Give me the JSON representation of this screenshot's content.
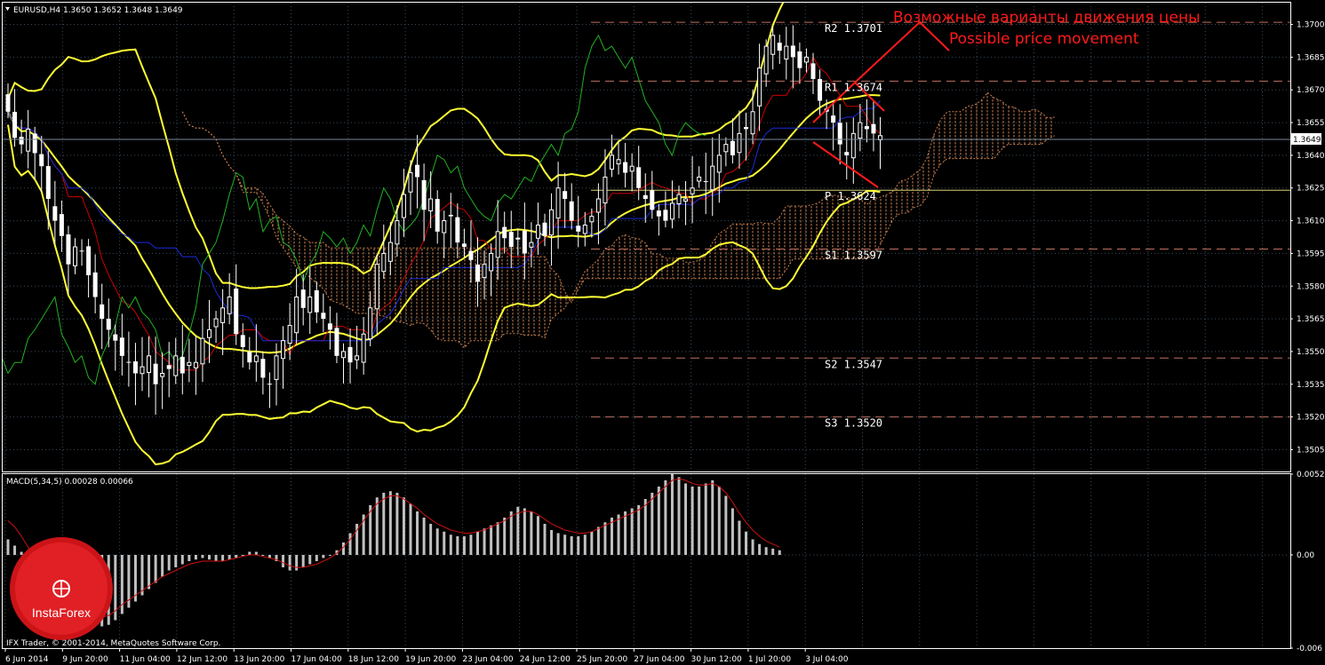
{
  "header": {
    "symbol_info": "EURUSD,H4  1.3650 1.3652 1.3648 1.3649",
    "macd_info": "MACD(5,34,5) 0.00028 0.00066",
    "copyright": "IFX Trader, © 2001-2014, MetaQuotes Software Corp."
  },
  "colors": {
    "background": "#000000",
    "grid": "#3a4a5a",
    "bull_candle": "#ffffff",
    "bear_candle": "#ffffff",
    "bollinger": "#ffff33",
    "tenkan": "#cc0000",
    "kijun": "#1a2bd8",
    "chikou": "#22b222",
    "kumo": "#c98050",
    "pivot_lines": "#c07060",
    "pivot_line": "#d8d070",
    "annotation": "#ff1a1a",
    "macd_hist": "#c0c0c0",
    "macd_signal": "#cc1111"
  },
  "annotation": {
    "text_ru": "Возможные варианты движения цены",
    "text_en": "Possible price movement"
  },
  "logo": {
    "text": "InstaForex"
  },
  "chart_data": [
    {
      "type": "candlestick",
      "title": "EURUSD,H4",
      "ylim": [
        1.3495,
        1.371
      ],
      "y_ticks": [
        "1.3700",
        "1.3685",
        "1.3670",
        "1.3655",
        "1.3640",
        "1.3625",
        "1.3610",
        "1.3595",
        "1.3580",
        "1.3565",
        "1.3550",
        "1.3535",
        "1.3520",
        "1.3505"
      ],
      "current_price": "1.3649",
      "x_labels": [
        "6 Jun 2014",
        "9 Jun 20:00",
        "11 Jun 04:00",
        "12 Jun 12:00",
        "13 Jun 20:00",
        "17 Jun 04:00",
        "18 Jun 12:00",
        "19 Jun 20:00",
        "23 Jun 04:00",
        "24 Jun 12:00",
        "25 Jun 20:00",
        "27 Jun 04:00",
        "30 Jun 12:00",
        "1 Jul 20:00",
        "3 Jul 04:00"
      ],
      "pivot_levels": [
        {
          "name": "R2",
          "value": 1.3701,
          "label": "R2  1.3701"
        },
        {
          "name": "R1",
          "value": 1.3674,
          "label": "R1  1.3674"
        },
        {
          "name": "P",
          "value": 1.3624,
          "label": "P  1.3624"
        },
        {
          "name": "S1",
          "value": 1.3597,
          "label": "S1  1.3597"
        },
        {
          "name": "S2",
          "value": 1.3547,
          "label": "S2  1.3547"
        },
        {
          "name": "S3",
          "value": 1.352,
          "label": "S3  1.3520"
        }
      ],
      "ohlc_close": [
        1.366,
        1.3648,
        1.3645,
        1.3652,
        1.3641,
        1.3635,
        1.362,
        1.361,
        1.3603,
        1.359,
        1.3598,
        1.3596,
        1.3585,
        1.3575,
        1.3565,
        1.356,
        1.3555,
        1.3548,
        1.3545,
        1.354,
        1.3543,
        1.3548,
        1.3535,
        1.354,
        1.3542,
        1.3548,
        1.354,
        1.3545,
        1.3545,
        1.3556,
        1.356,
        1.3565,
        1.357,
        1.3575,
        1.3558,
        1.3552,
        1.3545,
        1.3548,
        1.3538,
        1.3535,
        1.3548,
        1.3555,
        1.3562,
        1.3575,
        1.357,
        1.3575,
        1.3568,
        1.3565,
        1.356,
        1.3548,
        1.355,
        1.3545,
        1.3548,
        1.3558,
        1.357,
        1.359,
        1.3595,
        1.36,
        1.361,
        1.3622,
        1.3632,
        1.363,
        1.3615,
        1.362,
        1.3605,
        1.361,
        1.3612,
        1.36,
        1.3598,
        1.3592,
        1.3582,
        1.359,
        1.3595,
        1.3605,
        1.3602,
        1.3598,
        1.3602,
        1.3595,
        1.36,
        1.3608,
        1.3603,
        1.3615,
        1.3625,
        1.362,
        1.361,
        1.3605,
        1.3608,
        1.3612,
        1.362,
        1.363,
        1.364,
        1.3638,
        1.3632,
        1.3635,
        1.3625,
        1.362,
        1.3615,
        1.3612,
        1.361,
        1.3618,
        1.3622,
        1.362,
        1.3625,
        1.363,
        1.3628,
        1.3635,
        1.364,
        1.3645,
        1.364,
        1.365,
        1.3652,
        1.366,
        1.368,
        1.369,
        1.3695,
        1.3688,
        1.369,
        1.3685,
        1.368,
        1.3685,
        1.3675,
        1.3665,
        1.366,
        1.3655,
        1.3645,
        1.364,
        1.365,
        1.3655,
        1.3652,
        1.365,
        1.3649
      ]
    },
    {
      "type": "bar",
      "title": "MACD(5,34,5)",
      "ylim": [
        -0.006,
        0.0052
      ],
      "y_ticks": [
        "0.0052",
        "0.00",
        "-0.006"
      ],
      "signal_color": "#cc1111",
      "hist": [
        0.001,
        0.0006,
        0.0002,
        -0.0002,
        -0.0008,
        -0.0014,
        -0.002,
        -0.0026,
        -0.003,
        -0.0034,
        -0.0036,
        -0.004,
        -0.0043,
        -0.0045,
        -0.0046,
        -0.0045,
        -0.0042,
        -0.0038,
        -0.0034,
        -0.003,
        -0.0026,
        -0.0022,
        -0.0018,
        -0.0014,
        -0.001,
        -0.0008,
        -0.0006,
        -0.0004,
        -0.0003,
        -0.0002,
        -0.0003,
        -0.0004,
        -0.0004,
        -0.0003,
        -0.0002,
        0.0,
        0.0002,
        0.0002,
        0.0,
        -0.0002,
        -0.0004,
        -0.0008,
        -0.001,
        -0.001,
        -0.0008,
        -0.0006,
        -0.0004,
        -0.0002,
        0.0,
        0.0003,
        0.0008,
        0.0014,
        0.002,
        0.0026,
        0.0032,
        0.0037,
        0.004,
        0.0041,
        0.004,
        0.0037,
        0.0033,
        0.0028,
        0.0024,
        0.002,
        0.0017,
        0.0015,
        0.0013,
        0.0012,
        0.0012,
        0.0013,
        0.0015,
        0.0017,
        0.0019,
        0.0021,
        0.0024,
        0.0028,
        0.0031,
        0.003,
        0.0028,
        0.0025,
        0.002,
        0.0016,
        0.0014,
        0.0013,
        0.0012,
        0.0012,
        0.0013,
        0.0015,
        0.0018,
        0.0021,
        0.0024,
        0.0026,
        0.0028,
        0.003,
        0.0032,
        0.0036,
        0.004,
        0.0044,
        0.0048,
        0.0052,
        0.005,
        0.0046,
        0.0044,
        0.0044,
        0.0046,
        0.0048,
        0.0044,
        0.0038,
        0.003,
        0.0022,
        0.0015,
        0.001,
        0.0007,
        0.0005,
        0.0004,
        0.0003
      ],
      "signal": [
        0.0022,
        0.0018,
        0.0012,
        0.0005,
        -0.0002,
        -0.001,
        -0.0016,
        -0.0022,
        -0.0027,
        -0.003,
        -0.0033,
        -0.0036,
        -0.0038,
        -0.004,
        -0.004,
        -0.0039,
        -0.0036,
        -0.0032,
        -0.0029,
        -0.0026,
        -0.0023,
        -0.002,
        -0.0017,
        -0.0014,
        -0.0012,
        -0.001,
        -0.0008,
        -0.0006,
        -0.0005,
        -0.0004,
        -0.0004,
        -0.0004,
        -0.0004,
        -0.0003,
        -0.0002,
        -0.0001,
        0.0,
        0.0,
        -0.0001,
        -0.0002,
        -0.0003,
        -0.0005,
        -0.0007,
        -0.0008,
        -0.0008,
        -0.0007,
        -0.0006,
        -0.0004,
        -0.0002,
        0.0001,
        0.0005,
        0.001,
        0.0016,
        0.0022,
        0.0028,
        0.0033,
        0.0036,
        0.0038,
        0.0038,
        0.0036,
        0.0033,
        0.003,
        0.0026,
        0.0023,
        0.002,
        0.0018,
        0.0016,
        0.0015,
        0.0014,
        0.0014,
        0.0015,
        0.0016,
        0.0018,
        0.002,
        0.0022,
        0.0025,
        0.0027,
        0.0028,
        0.0028,
        0.0026,
        0.0023,
        0.002,
        0.0018,
        0.0016,
        0.0015,
        0.0014,
        0.0014,
        0.0015,
        0.0017,
        0.0019,
        0.0021,
        0.0023,
        0.0025,
        0.0027,
        0.0029,
        0.0032,
        0.0036,
        0.004,
        0.0044,
        0.0048,
        0.0049,
        0.0048,
        0.0046,
        0.0045,
        0.0045,
        0.0046,
        0.0044,
        0.004,
        0.0034,
        0.0027,
        0.0021,
        0.0016,
        0.0012,
        0.0009,
        0.0007,
        0.0005
      ]
    }
  ]
}
